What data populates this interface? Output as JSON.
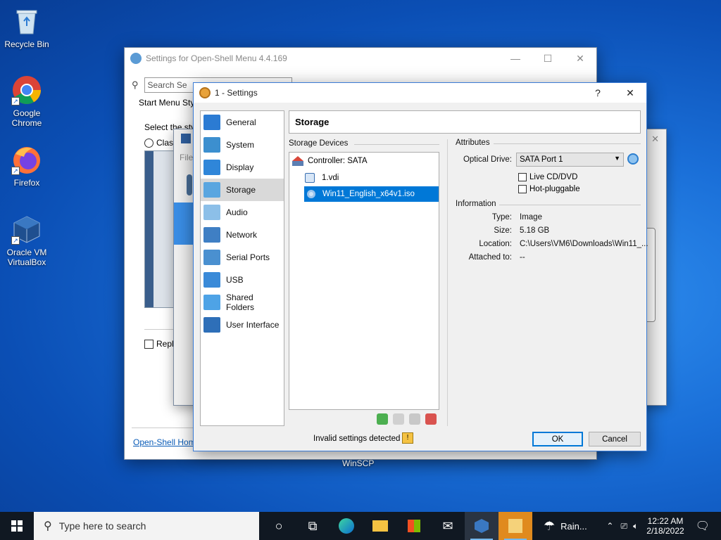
{
  "desktop": {
    "icons": [
      {
        "label": "Recycle Bin",
        "icon": "recycle-bin-icon"
      },
      {
        "label": "Google Chrome",
        "icon": "chrome-icon"
      },
      {
        "label": "Firefox",
        "icon": "firefox-icon"
      },
      {
        "label": "Oracle VM VirtualBox",
        "icon": "virtualbox-icon"
      }
    ],
    "behind_label": "WinSCP"
  },
  "openshell": {
    "title": "Settings for Open-Shell Menu 4.4.169",
    "search_placeholder": "Search Se",
    "tab": "Start Menu Sty",
    "select_text": "Select the sty",
    "classic_option": "Classi",
    "replace_option": "Repla",
    "footer_link": "Open-Shell Hom"
  },
  "vbox_mgr": {
    "file_menu": "File"
  },
  "dialog": {
    "title": "1 - Settings",
    "help": "?",
    "close": "✕",
    "sidebar": [
      {
        "label": "General",
        "color": "#2b7bd3"
      },
      {
        "label": "System",
        "color": "#3c8fcf"
      },
      {
        "label": "Display",
        "color": "#2f86d9"
      },
      {
        "label": "Storage",
        "color": "#5aa6e0"
      },
      {
        "label": "Audio",
        "color": "#8cbfe8"
      },
      {
        "label": "Network",
        "color": "#3f7fc4"
      },
      {
        "label": "Serial Ports",
        "color": "#4a90d0"
      },
      {
        "label": "USB",
        "color": "#3a8ad8"
      },
      {
        "label": "Shared Folders",
        "color": "#4ea3e6"
      },
      {
        "label": "User Interface",
        "color": "#2e6fb8"
      }
    ],
    "active_section": "Storage",
    "page_title": "Storage",
    "storage_devices_label": "Storage Devices",
    "tree": {
      "controller": "Controller: SATA",
      "disk": "1.vdi",
      "optical": "Win11_English_x64v1.iso"
    },
    "attributes_label": "Attributes",
    "optical_drive_label": "Optical Drive:",
    "optical_drive_value": "SATA Port 1",
    "live_cd": "Live CD/DVD",
    "hot_pluggable": "Hot-pluggable",
    "information_label": "Information",
    "info": [
      {
        "label": "Type:",
        "value": "Image"
      },
      {
        "label": "Size:",
        "value": "5.18 GB"
      },
      {
        "label": "Location:",
        "value": "C:\\Users\\VM6\\Downloads\\Win11_..."
      },
      {
        "label": "Attached to:",
        "value": "--"
      }
    ],
    "status": "Invalid settings detected",
    "ok": "OK",
    "cancel": "Cancel"
  },
  "taskbar": {
    "search_placeholder": "Type here to search",
    "weather": "Rain...",
    "time": "12:22 AM",
    "date": "2/18/2022"
  }
}
